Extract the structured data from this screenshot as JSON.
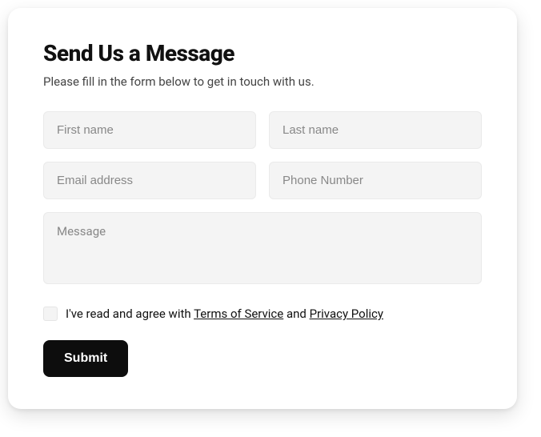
{
  "form": {
    "heading": "Send Us a Message",
    "subheading": "Please fill in the form below to get in touch with us.",
    "fields": {
      "first_name": {
        "placeholder": "First name",
        "value": ""
      },
      "last_name": {
        "placeholder": "Last name",
        "value": ""
      },
      "email": {
        "placeholder": "Email address",
        "value": ""
      },
      "phone": {
        "placeholder": "Phone Number",
        "value": ""
      },
      "message": {
        "placeholder": "Message",
        "value": ""
      }
    },
    "consent": {
      "prefix": "I've read and agree with ",
      "tos_label": "Terms of Service",
      "middle": " and ",
      "privacy_label": "Privacy Policy",
      "checked": false
    },
    "submit_label": "Submit"
  }
}
